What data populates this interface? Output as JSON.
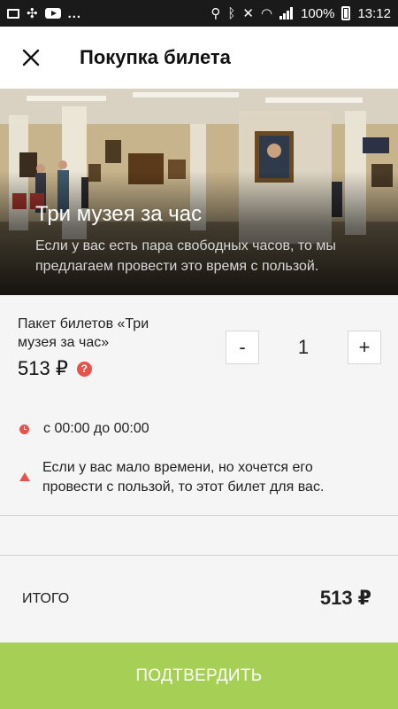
{
  "status_bar": {
    "left_dots": "...",
    "battery": "100%",
    "time": "13:12"
  },
  "header": {
    "close_icon": "close-icon",
    "title": "Покупка билета"
  },
  "hero": {
    "title": "Три музея за час",
    "description": "Если у вас есть пара свободных часов, то мы предлагаем провести это время с пользой."
  },
  "ticket": {
    "package_name": "Пакет билетов «Три музея за час»",
    "price": "513 ₽",
    "help_icon": "?",
    "quantity": "1",
    "minus_label": "-",
    "plus_label": "+",
    "time_range": "с 00:00 до 00:00",
    "note": "Если у вас мало времени, но хочется его провести с пользой, то этот билет для вас."
  },
  "total": {
    "label": "ИТОГО",
    "value": "513 ₽"
  },
  "confirm_button": {
    "label": "ПОДТВЕРДИТЬ"
  },
  "colors": {
    "accent_green": "#a6cf55",
    "alert_red": "#e5534b"
  }
}
